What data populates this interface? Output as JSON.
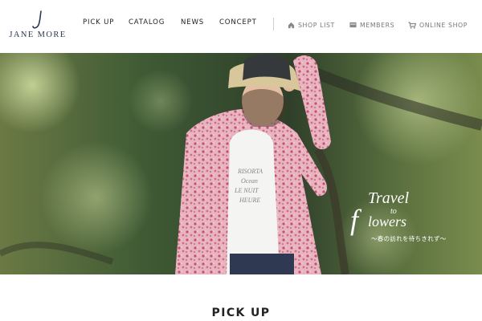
{
  "brand": {
    "mark": "J",
    "name": "JANE MORE"
  },
  "nav": {
    "items": [
      "PICK UP",
      "CATALOG",
      "NEWS",
      "CONCEPT"
    ]
  },
  "utility": {
    "shop_list": {
      "label": "SHOP LIST",
      "icon": "home-icon"
    },
    "members": {
      "label": "MEMBERS",
      "icon": "card-icon"
    },
    "online_shop": {
      "label": "ONLINE SHOP",
      "icon": "cart-icon"
    }
  },
  "hero": {
    "line1": "Travel",
    "line2": "to",
    "line3_initial": "f",
    "line3_rest": "lowers",
    "line4": "〜春の訪れを待ちきれず〜"
  },
  "section": {
    "title": "PICK UP"
  },
  "colors": {
    "brand": "#2b3852",
    "nav_text": "#222222",
    "util_text": "#777777"
  }
}
